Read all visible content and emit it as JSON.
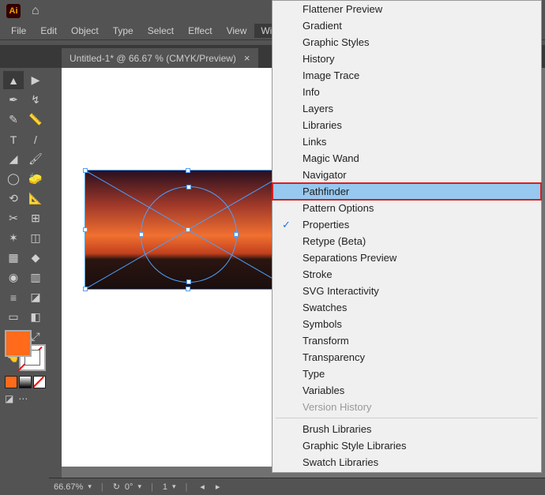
{
  "app": {
    "logo": "Ai"
  },
  "menus": {
    "items": [
      "File",
      "Edit",
      "Object",
      "Type",
      "Select",
      "Effect",
      "View",
      "Window"
    ],
    "activeIndex": 7
  },
  "tab": {
    "title": "Untitled-1* @ 66.67 % (CMYK/Preview)",
    "close": "×"
  },
  "tools": [
    "▲",
    "▶",
    "✒",
    "↯",
    "✎",
    "📏",
    "T",
    "/",
    "◢",
    "🖌",
    "◯",
    "🧽",
    "⟲",
    "📐",
    "✂",
    "⊞",
    "✶",
    "◫",
    "▦",
    "◆",
    "◉",
    "▥",
    "≡",
    "◪",
    "▭",
    "◧",
    "✢",
    "⤢",
    "👆",
    "🔍"
  ],
  "status": {
    "zoom": "66.67%",
    "rot_label": "↻",
    "rotation": "0°",
    "artboard": "1"
  },
  "windowMenu": {
    "items": [
      {
        "label": "Flattener Preview"
      },
      {
        "label": "Gradient"
      },
      {
        "label": "Graphic Styles"
      },
      {
        "label": "History"
      },
      {
        "label": "Image Trace"
      },
      {
        "label": "Info"
      },
      {
        "label": "Layers"
      },
      {
        "label": "Libraries"
      },
      {
        "label": "Links"
      },
      {
        "label": "Magic Wand"
      },
      {
        "label": "Navigator"
      },
      {
        "label": "Pathfinder",
        "selected": true,
        "highlight": true
      },
      {
        "label": "Pattern Options"
      },
      {
        "label": "Properties",
        "checked": true
      },
      {
        "label": "Retype (Beta)"
      },
      {
        "label": "Separations Preview"
      },
      {
        "label": "Stroke"
      },
      {
        "label": "SVG Interactivity"
      },
      {
        "label": "Swatches"
      },
      {
        "label": "Symbols"
      },
      {
        "label": "Transform"
      },
      {
        "label": "Transparency"
      },
      {
        "label": "Type"
      },
      {
        "label": "Variables"
      },
      {
        "label": "Version History",
        "disabled": true
      }
    ],
    "libraries": [
      "Brush Libraries",
      "Graphic Style Libraries",
      "Swatch Libraries"
    ]
  }
}
